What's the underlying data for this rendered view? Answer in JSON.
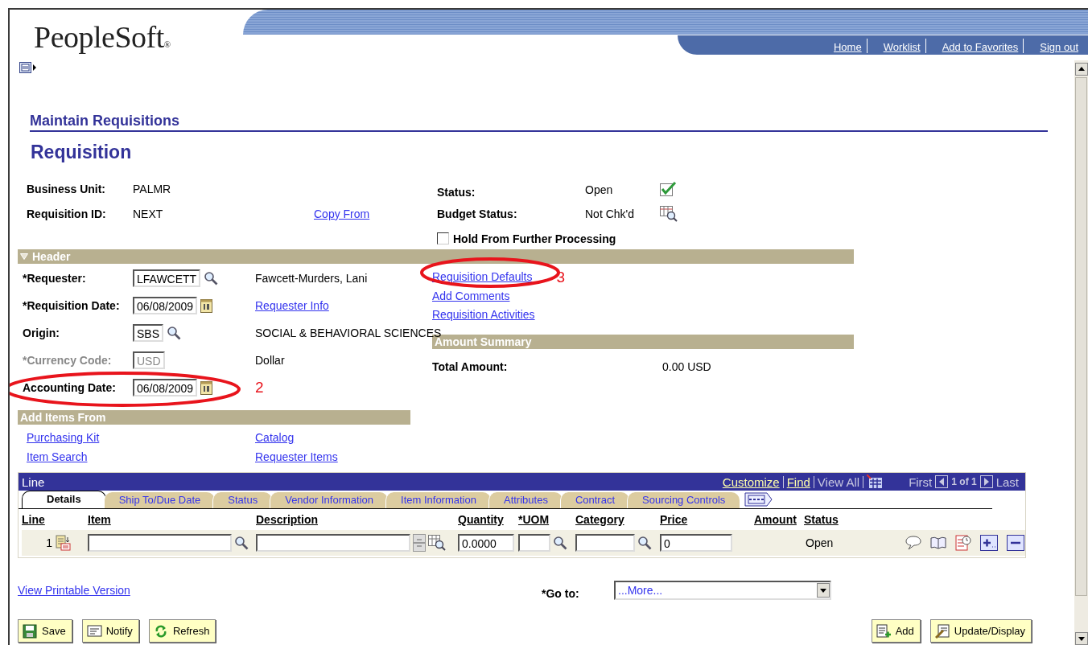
{
  "banner": {
    "logo": "PeopleSoft",
    "logo_mark": "®",
    "links": [
      "Home",
      "Worklist",
      "Add to Favorites",
      "Sign out"
    ]
  },
  "page": {
    "breadcrumb": "Maintain Requisitions",
    "title": "Requisition"
  },
  "summary": {
    "business_unit": {
      "label": "Business Unit:",
      "value": "PALMR"
    },
    "requisition_id": {
      "label": "Requisition ID:",
      "value": "NEXT"
    },
    "copy_from": "Copy From",
    "status": {
      "label": "Status:",
      "value": "Open"
    },
    "budget_status": {
      "label": "Budget Status:",
      "value": "Not Chk'd"
    },
    "hold": {
      "label": "Hold From Further Processing",
      "checked": false
    }
  },
  "header": {
    "title": "Header",
    "expanded": true,
    "fields": [
      {
        "label": "*Requester:",
        "kind": "lookup",
        "value": "LFAWCETT",
        "disabled": false,
        "description": "Fawcett-Murders, Lani"
      },
      {
        "label": "*Requisition Date:",
        "kind": "date",
        "value": "06/08/2009",
        "disabled": false,
        "link": "Requester Info"
      },
      {
        "label": "Origin:",
        "kind": "lookup",
        "value": "SBS",
        "disabled": false,
        "description": "SOCIAL & BEHAVIORAL SCIENCES"
      },
      {
        "label": "*Currency Code:",
        "kind": "text",
        "value": "USD",
        "disabled": true,
        "description": "Dollar"
      },
      {
        "label": "Accounting Date:",
        "kind": "date",
        "value": "06/08/2009",
        "disabled": false,
        "annotation": "2"
      }
    ],
    "links": [
      {
        "label": "Requisition Defaults",
        "annotation": "3"
      },
      {
        "label": "Add Comments"
      },
      {
        "label": "Requisition Activities"
      }
    ],
    "amount_summary": {
      "title": "Amount Summary",
      "label": "Total Amount:",
      "value": "0.00",
      "currency": "USD"
    }
  },
  "add_items": {
    "title": "Add Items From",
    "links": [
      "Purchasing Kit",
      "Catalog",
      "Item Search",
      "Requester Items"
    ]
  },
  "line_grid": {
    "title": "Line",
    "nav": {
      "customize": "Customize",
      "find": "Find",
      "view_all": "View All",
      "first": "First",
      "count": "1 of 1",
      "last": "Last"
    },
    "tabs": [
      {
        "label": "Details",
        "selected": true
      },
      {
        "label": "Ship To/Due Date",
        "selected": false
      },
      {
        "label": "Status",
        "selected": false
      },
      {
        "label": "Vendor Information",
        "selected": false
      },
      {
        "label": "Item Information",
        "selected": false
      },
      {
        "label": "Attributes",
        "selected": false
      },
      {
        "label": "Contract",
        "selected": false
      },
      {
        "label": "Sourcing Controls",
        "selected": false
      }
    ],
    "columns": [
      "Line",
      "Item",
      "Description",
      "Quantity",
      "*UOM",
      "Category",
      "Price",
      "Amount",
      "Status"
    ],
    "rows": [
      {
        "line": "1",
        "quantity": "0.0000",
        "price": "0",
        "status": "Open"
      }
    ]
  },
  "footer": {
    "printable": "View Printable Version",
    "goto": {
      "label": "*Go to:",
      "value": "...More..."
    },
    "buttons_left": [
      {
        "label": "Save",
        "kind": "save"
      },
      {
        "label": "Notify",
        "kind": "notify"
      },
      {
        "label": "Refresh",
        "kind": "refresh"
      }
    ],
    "buttons_right": [
      {
        "label": "Add",
        "kind": "add"
      },
      {
        "label": "Update/Display",
        "kind": "update"
      }
    ]
  }
}
